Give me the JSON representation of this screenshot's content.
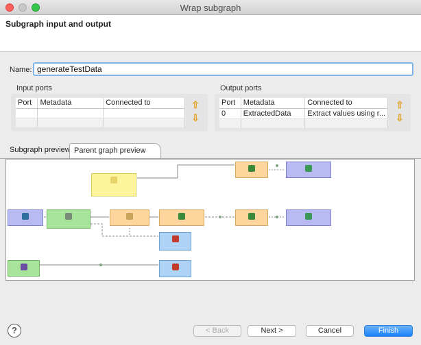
{
  "window": {
    "title": "Wrap subgraph"
  },
  "header": {
    "heading": "Subgraph input and output"
  },
  "name": {
    "label": "Name:",
    "value": "generateTestData"
  },
  "input_ports": {
    "title": "Input ports",
    "columns": [
      "Port",
      "Metadata",
      "Connected to"
    ],
    "rows": []
  },
  "output_ports": {
    "title": "Output ports",
    "columns": [
      "Port",
      "Metadata",
      "Connected to"
    ],
    "rows": [
      {
        "port": "0",
        "metadata": "ExtractedData",
        "connected_to": "Extract values using r..."
      }
    ]
  },
  "tabs": [
    {
      "label": "Subgraph preview",
      "active": false
    },
    {
      "label": "Parent graph preview",
      "active": true
    }
  ],
  "buttons": {
    "back": "< Back",
    "next": "Next >",
    "cancel": "Cancel",
    "finish": "Finish",
    "help": "?"
  },
  "icons": {
    "move_up": "arrow-up-icon",
    "move_down": "arrow-down-icon"
  },
  "colors": {
    "accent": "#1a82fb",
    "port_arrows": "#e2a326"
  }
}
